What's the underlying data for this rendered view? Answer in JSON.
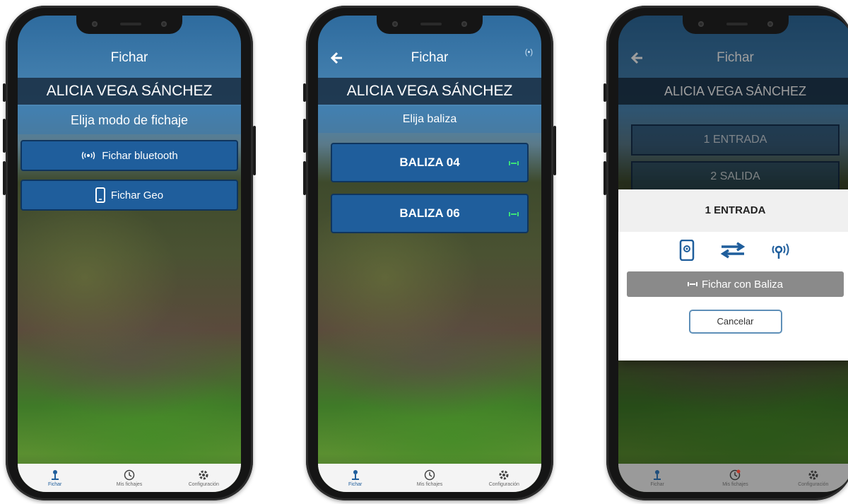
{
  "colors": {
    "brand_blue": "#1f5e9c",
    "dialog_gray": "#8a8a8a",
    "tab_active": "#1f5e9c"
  },
  "screen1": {
    "title": "Fichar",
    "user_name": "ALICIA VEGA SÁNCHEZ",
    "prompt": "Elija modo de fichaje",
    "buttons": [
      {
        "label": "Fichar bluetooth",
        "icon": "bluetooth-signal-icon"
      },
      {
        "label": "Fichar Geo",
        "icon": "phone-icon"
      }
    ]
  },
  "screen2": {
    "title": "Fichar",
    "user_name": "ALICIA VEGA SÁNCHEZ",
    "prompt": "Elija baliza",
    "status_icon": "(•)",
    "beacons": [
      {
        "label": "BALIZA 04",
        "status_icon": "beacon-active-icon"
      },
      {
        "label": "BALIZA 06",
        "status_icon": "beacon-active-icon"
      }
    ]
  },
  "screen3": {
    "title": "Fichar",
    "user_name": "ALICIA VEGA SÁNCHEZ",
    "options": [
      "1 ENTRADA",
      "2 SALIDA"
    ],
    "dialog": {
      "title": "1 ENTRADA",
      "icons": [
        "phone-location-icon",
        "swap-arrows-icon",
        "beacon-signal-icon"
      ],
      "action_label": "Fichar con Baliza",
      "cancel_label": "Cancelar"
    }
  },
  "tabbar": {
    "items": [
      {
        "label": "Fichar",
        "icon": "pin-icon"
      },
      {
        "label": "Mis fichajes",
        "icon": "clock-icon"
      },
      {
        "label": "Configuración",
        "icon": "gear-icon"
      }
    ]
  }
}
